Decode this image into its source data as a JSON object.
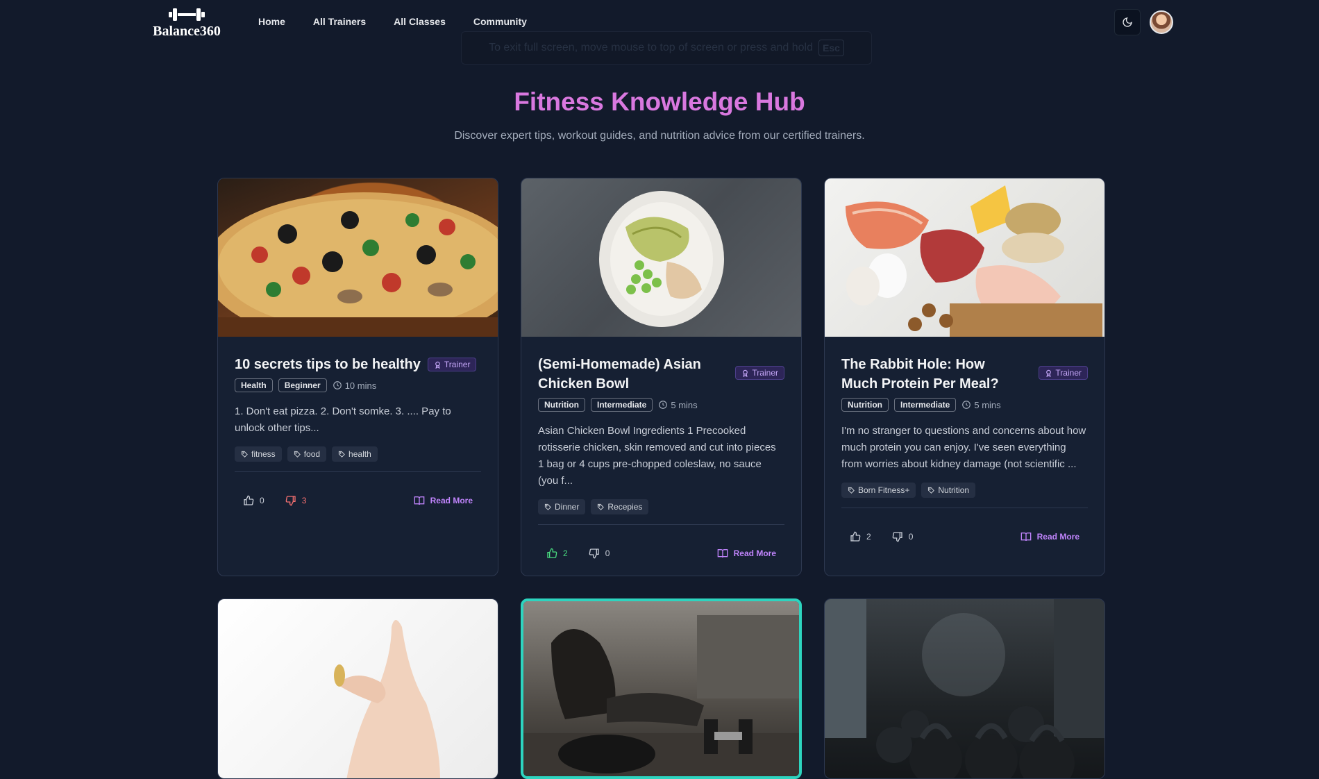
{
  "brand": {
    "name": "Balance360"
  },
  "nav": {
    "links": [
      "Home",
      "All Trainers",
      "All Classes",
      "Community"
    ]
  },
  "fullscreen_notice": {
    "text": "To exit full screen, move mouse to top of screen or press and hold",
    "key": "Esc"
  },
  "hero": {
    "title": "Fitness Knowledge Hub",
    "subtitle": "Discover expert tips, workout guides, and nutrition advice from our certified trainers."
  },
  "cards": [
    {
      "title": "10 secrets tips to be healthy",
      "badge": "Trainer",
      "category": "Health",
      "level": "Beginner",
      "duration": "10 mins",
      "excerpt": "1. Don't eat pizza. 2. Don't somke. 3. .... Pay to unlock other tips...",
      "tags": [
        "fitness",
        "food",
        "health"
      ],
      "likes": "0",
      "dislikes": "3",
      "read_more": "Read More",
      "image": "pizza"
    },
    {
      "title": "(Semi-Homemade) Asian Chicken Bowl",
      "badge": "Trainer",
      "category": "Nutrition",
      "level": "Intermediate",
      "duration": "5 mins",
      "excerpt": "Asian Chicken Bowl Ingredients 1 Precooked rotisserie chicken, skin removed and cut into pieces 1 bag or 4 cups pre-chopped coleslaw, no sauce (you f...",
      "tags": [
        "Dinner",
        "Recepies"
      ],
      "likes": "2",
      "dislikes": "0",
      "read_more": "Read More",
      "image": "salad-bowl"
    },
    {
      "title": "The Rabbit Hole: How Much Protein Per Meal?",
      "badge": "Trainer",
      "category": "Nutrition",
      "level": "Intermediate",
      "duration": "5 mins",
      "excerpt": "I'm no stranger to questions and concerns about how much protein you can enjoy. I've seen everything from worries about kidney damage (not scientific ...",
      "tags": [
        "Born Fitness+",
        "Nutrition"
      ],
      "likes": "2",
      "dislikes": "0",
      "read_more": "Read More",
      "image": "protein-foods"
    }
  ],
  "second_row_images": [
    "capsule-hand",
    "sit-ups-dumbbells",
    "kettlebell-gym"
  ],
  "colors": {
    "accent": "#d978df",
    "link": "#c084fc",
    "like_active": "#4ade80",
    "dislike_active": "#f87171",
    "highlight_border": "#2dd4bf"
  }
}
